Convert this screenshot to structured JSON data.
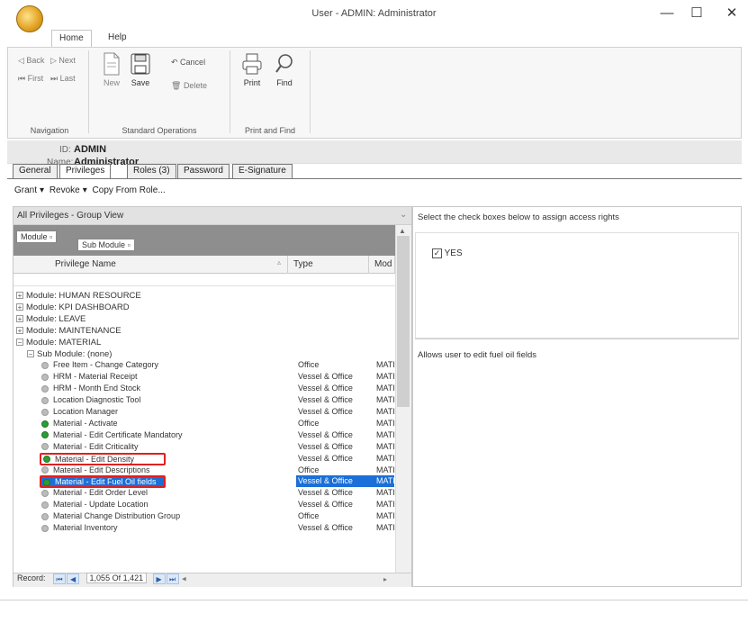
{
  "window": {
    "title": "User - ADMIN: Administrator",
    "min": "—",
    "max": "☐",
    "close": "✕"
  },
  "ribbon": {
    "tabs": [
      "Home",
      "Help"
    ],
    "navigation": {
      "back": "Back",
      "next": "Next",
      "first": "First",
      "last": "Last",
      "group_label": "Navigation"
    },
    "standard": {
      "new": "New",
      "save": "Save",
      "cancel": "Cancel",
      "delete": "Delete",
      "group_label": "Standard Operations"
    },
    "print_find": {
      "print": "Print",
      "find": "Find",
      "group_label": "Print and Find"
    }
  },
  "record": {
    "id_label": "ID:",
    "id_value": "ADMIN",
    "name_label": "Name:",
    "name_value": "Administrator"
  },
  "record_tabs": [
    "General",
    "Privileges",
    "Roles (3)",
    "Password",
    "E-Signature"
  ],
  "actions": [
    "Grant",
    "Revoke",
    "Copy From Role..."
  ],
  "grid": {
    "title": "All Privileges - Group View",
    "group_chips": [
      "Module",
      "Sub Module"
    ],
    "columns": [
      "Privilege Name",
      "Type",
      "Mod"
    ],
    "modules": [
      "Module: HUMAN RESOURCE",
      "Module: KPI DASHBOARD",
      "Module: LEAVE",
      "Module: MAINTENANCE",
      "Module: MATERIAL"
    ],
    "submodule": "Sub Module: (none)",
    "rows": [
      {
        "name": "Free Item - Change Category",
        "type": "Office",
        "mod": "MATI",
        "granted": false
      },
      {
        "name": "HRM - Material Receipt",
        "type": "Vessel & Office",
        "mod": "MATI",
        "granted": false
      },
      {
        "name": "HRM - Month End Stock",
        "type": "Vessel & Office",
        "mod": "MATI",
        "granted": false
      },
      {
        "name": "Location Diagnostic Tool",
        "type": "Vessel & Office",
        "mod": "MATI",
        "granted": false
      },
      {
        "name": "Location Manager",
        "type": "Vessel & Office",
        "mod": "MATI",
        "granted": false
      },
      {
        "name": "Material - Activate",
        "type": "Office",
        "mod": "MATI",
        "granted": true
      },
      {
        "name": "Material - Edit Certificate Mandatory",
        "type": "Vessel & Office",
        "mod": "MATI",
        "granted": true
      },
      {
        "name": "Material - Edit Criticality",
        "type": "Vessel & Office",
        "mod": "MATI",
        "granted": false
      },
      {
        "name": "Material - Edit Density",
        "type": "Vessel & Office",
        "mod": "MATI",
        "granted": true
      },
      {
        "name": "Material - Edit Descriptions",
        "type": "Office",
        "mod": "MATI",
        "granted": false
      },
      {
        "name": "Material - Edit Fuel Oil fields",
        "type": "Vessel & Office",
        "mod": "MATI",
        "granted": true
      },
      {
        "name": "Material - Edit Order Level",
        "type": "Vessel & Office",
        "mod": "MATI",
        "granted": false
      },
      {
        "name": "Material - Update Location",
        "type": "Vessel & Office",
        "mod": "MATI",
        "granted": false
      },
      {
        "name": "Material Change Distribution Group",
        "type": "Office",
        "mod": "MATI",
        "granted": false
      },
      {
        "name": "Material Inventory",
        "type": "Vessel & Office",
        "mod": "MATI",
        "granted": false
      }
    ],
    "navigator": {
      "label": "Record:",
      "position": "1,055 Of 1,421"
    }
  },
  "right_panel": {
    "hint": "Select the check boxes below to assign access rights",
    "checkbox_label": "YES",
    "checkbox_checked": true,
    "description": "Allows user to edit fuel oil fields"
  }
}
